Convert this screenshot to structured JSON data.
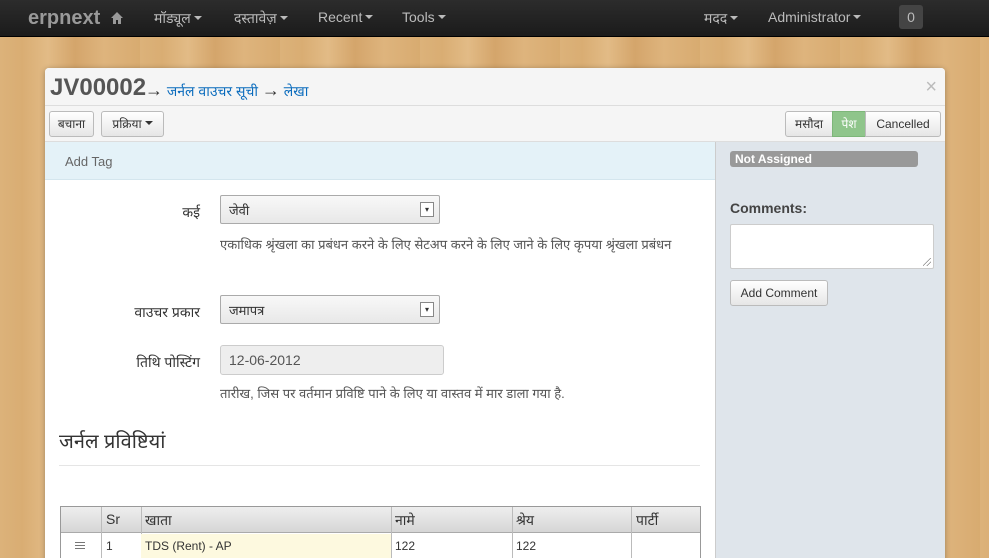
{
  "navbar": {
    "brand": "erpnext",
    "menus": [
      "मॉड्यूल",
      "दस्तावेज़",
      "Recent",
      "Tools"
    ],
    "help": "मदद",
    "user": "Administrator",
    "count": "0"
  },
  "doc": {
    "title": "JV00002",
    "arrow1": "→",
    "crumb1": "जर्नल वाउचर सूची",
    "arrow2": "→",
    "crumb2": "लेखा",
    "close": "×"
  },
  "toolbar": {
    "save_label": "बचाना",
    "actions_label": "प्रक्रिया",
    "status": [
      "मसौदा",
      "पेश",
      "Cancelled"
    ],
    "active_status": "पेश"
  },
  "tags": {
    "add_tag": "Add Tag"
  },
  "form": {
    "series_label": "कई",
    "series_value": "जेवी",
    "series_help": "एकाधिक श्रृंखला का प्रबंधन करने के लिए सेटअप करने के लिए जाने के लिए कृपया श्रृंखला प्रबंधन",
    "voucher_type_label": "वाउचर प्रकार",
    "voucher_type_value": "जमापत्र",
    "posting_date_label": "तिथि पोस्टिंग",
    "posting_date_value": "12-06-2012",
    "posting_date_help": "तारीख, जिस पर वर्तमान प्रविष्टि पाने के लिए या वास्तव में मार डाला गया है."
  },
  "entries": {
    "title": "जर्नल प्रविष्टियां",
    "columns": [
      "Sr",
      "खाता",
      "नामे",
      "श्रेय",
      "पार्टी"
    ],
    "rows": [
      {
        "sr": "1",
        "account": "TDS (Rent) - AP",
        "debit": "122",
        "credit": "122",
        "party": ""
      }
    ]
  },
  "sidebar": {
    "assigned": "Not Assigned",
    "comments_label": "Comments:",
    "comment_value": "",
    "add_comment": "Add Comment"
  }
}
